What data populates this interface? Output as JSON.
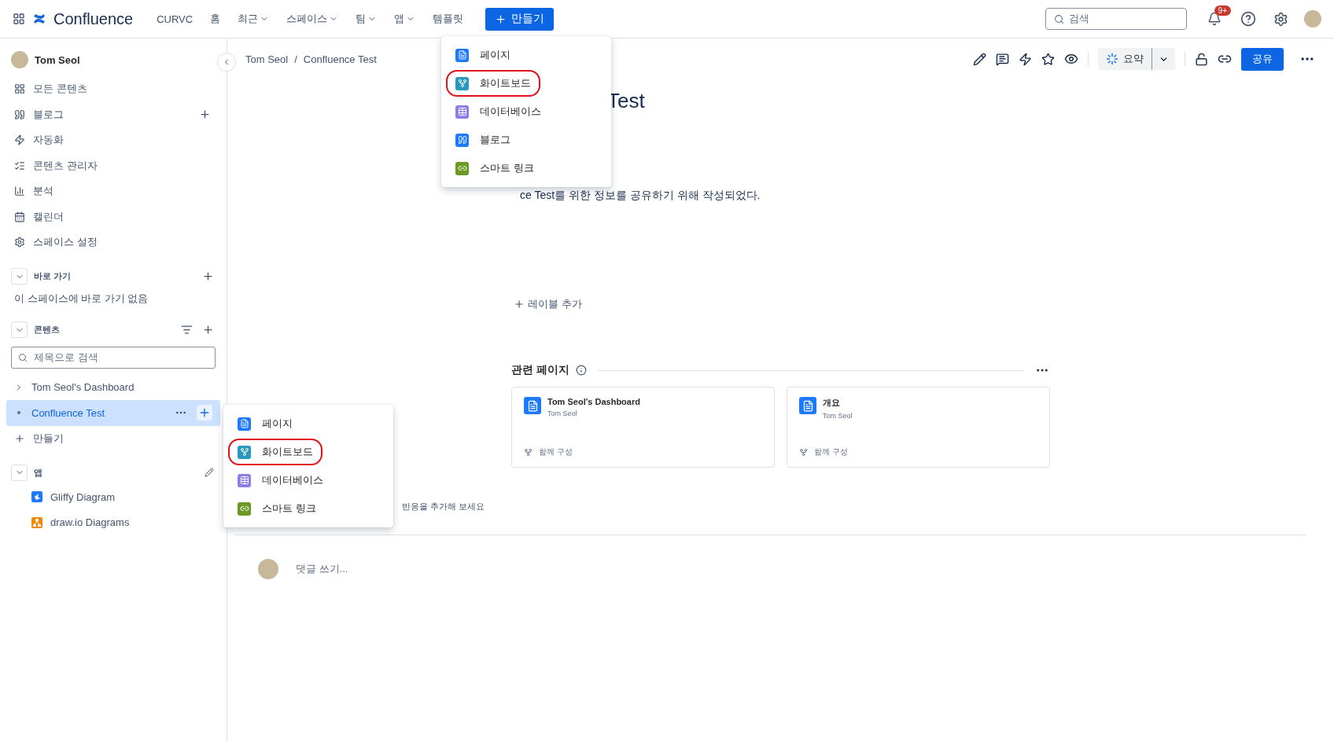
{
  "topnav": {
    "logo": "Confluence",
    "items": [
      {
        "label": "CURVC",
        "dropdown": false
      },
      {
        "label": "홈",
        "dropdown": false
      },
      {
        "label": "최근",
        "dropdown": true
      },
      {
        "label": "스페이스",
        "dropdown": true
      },
      {
        "label": "팀",
        "dropdown": true
      },
      {
        "label": "앱",
        "dropdown": true
      },
      {
        "label": "템플릿",
        "dropdown": false
      }
    ],
    "create_button": "만들기",
    "search": {
      "placeholder": "검색"
    },
    "notification_badge": "9+"
  },
  "sidebar": {
    "space_name": "Tom Seol",
    "items": [
      {
        "label": "모든 콘텐츠",
        "kind": "grid",
        "addable": false
      },
      {
        "label": "블로그",
        "kind": "quote",
        "addable": true
      },
      {
        "label": "자동화",
        "kind": "bolt",
        "addable": false
      },
      {
        "label": "콘텐츠 관리자",
        "kind": "checklist",
        "addable": false
      },
      {
        "label": "분석",
        "kind": "chart",
        "addable": false
      },
      {
        "label": "캘린더",
        "kind": "calendar",
        "addable": false
      },
      {
        "label": "스페이스 설정",
        "kind": "gear",
        "addable": false
      }
    ],
    "shortcuts": {
      "title": "바로 가기",
      "expanded": true,
      "empty_text": "이 스페이스에 바로 가기 없음"
    },
    "content": {
      "title": "콘텐츠",
      "expanded": true,
      "search": {
        "placeholder": "제목으로 검색"
      },
      "tree": [
        {
          "label": "Tom Seol's Dashboard",
          "selected": false,
          "has_children": true
        },
        {
          "label": "Confluence Test",
          "selected": true,
          "has_children": false
        }
      ],
      "create": "만들기"
    },
    "apps": {
      "title": "앱",
      "expanded": true,
      "items": [
        {
          "label": "Gliffy Diagram",
          "kind": "gliffy"
        },
        {
          "label": "draw.io Diagrams",
          "kind": "drawio"
        }
      ]
    }
  },
  "breadcrumb": {
    "items": [
      "Tom Seol",
      "Confluence Test"
    ],
    "separator": "/"
  },
  "toolbar": {
    "summary_button": "요약",
    "share_button": "공유"
  },
  "page": {
    "title": "Test",
    "body": "ce Test를 위한 정보를 공유하기 위해 작성되었다.",
    "add_label": "레이블 추가",
    "related": {
      "title": "관련 페이지",
      "cards": [
        {
          "title": "Tom Seol's Dashboard",
          "author": "Tom Seol",
          "footer": "함께 구성"
        },
        {
          "title": "개요",
          "author": "Tom Seol",
          "footer": "함께 구성"
        }
      ]
    },
    "reactions_hint": "반응을 추가해 보세요",
    "comment_placeholder": "댓글 쓰기..."
  },
  "create_menu": {
    "items": [
      {
        "label": "페이지",
        "kind": "page",
        "circled": false
      },
      {
        "label": "화이트보드",
        "kind": "whiteboard",
        "circled": true
      },
      {
        "label": "데이터베이스",
        "kind": "database",
        "circled": false
      },
      {
        "label": "블로그",
        "kind": "blog",
        "circled": false
      },
      {
        "label": "스마트 링크",
        "kind": "link",
        "circled": false
      }
    ]
  },
  "tree_create_menu": {
    "items": [
      {
        "label": "페이지",
        "kind": "page",
        "circled": false
      },
      {
        "label": "화이트보드",
        "kind": "whiteboard",
        "circled": true
      },
      {
        "label": "데이터베이스",
        "kind": "database",
        "circled": false
      },
      {
        "label": "스마트 링크",
        "kind": "link",
        "circled": false
      }
    ]
  }
}
